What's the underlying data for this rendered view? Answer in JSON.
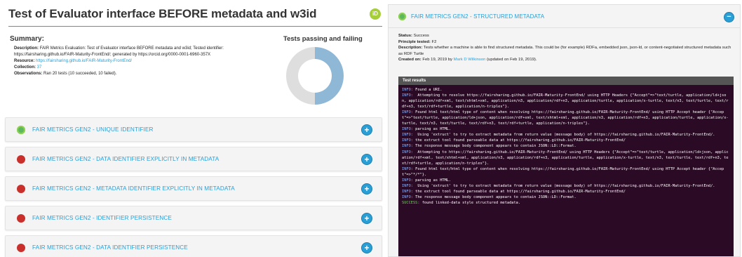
{
  "page": {
    "title": "Test of Evaluator interface BEFORE metadata and w3id",
    "orcid_badge": "iD"
  },
  "summary": {
    "heading": "Summary:",
    "description_label": "Description:",
    "description": "FAIR Metrics Evaluation: Test of Evaluator interface BEFORE metadata and w3id; Tested identifier: https://fairsharing.github.io/FAIR-Maturity-FrontEnd/; generated by https://orcid.org/0000-0001-6960-357X",
    "resource_label": "Resource:",
    "resource": "https://fairsharing.github.io/FAIR-Maturity-FrontEnd/",
    "collection_label": "Collection:",
    "collection": "37",
    "observations_label": "Observations:",
    "observations": "Ran 20 tests (10 succeeded, 10 failed)."
  },
  "donut": {
    "title": "Tests passing and failing",
    "passed": 10,
    "failed": 10,
    "colors": {
      "passed": "#8fb7d6",
      "failed": "#dedede"
    }
  },
  "tests": [
    {
      "label": "FAIR METRICS GEN2 - UNIQUE IDENTIFIER",
      "status": "pass"
    },
    {
      "label": "FAIR METRICS GEN2 - DATA IDENTIFIER EXPLICITLY IN METADATA",
      "status": "fail"
    },
    {
      "label": "FAIR METRICS GEN2 - METADATA IDENTIFIER EXPLICITLY IN METADATA",
      "status": "fail"
    },
    {
      "label": "FAIR METRICS GEN2 - IDENTIFIER PERSISTENCE",
      "status": "fail"
    },
    {
      "label": "FAIR METRICS GEN2 - DATA IDENTIFIER PERSISTENCE",
      "status": "fail"
    }
  ],
  "expand_symbol": "+",
  "collapse_symbol": "−",
  "detail": {
    "title": "FAIR METRICS GEN2 - STRUCTURED METADATA",
    "status_label": "Status:",
    "status": "Success",
    "principle_label": "Principle tested:",
    "principle": "F2",
    "description_label": "Description:",
    "description": "Tests whether a machine is able to find structured metadata. This could be (for example) RDFa, embedded json, json-ld, or content-negotiated structured metadata such as RDF Turtle",
    "created_label": "Created on:",
    "created_date": "Feb 19, 2019",
    "created_by": "by",
    "author": "Mark D Wilkinson",
    "updated": "(updated on Feb 19, 2019)."
  },
  "results": {
    "heading": "Test results",
    "lines": [
      {
        "level": "INFO:",
        "text": " Found a URI."
      },
      {
        "level": "INFO:",
        "text": "  Attempting to resolve https://fairsharing.github.io/FAIR-Maturity-FrontEnd/ using HTTP Headers {\"Accept\"=>\"text/turtle, application/ld+json, application/rdf+xml, text/xhtml+xml, application/n3, application/rdf+n3, application/turtle, application/x-turtle, text/n3, text/turtle, text/rdf+n3, text/rdf+turtle, application/n-triples\"}."
      },
      {
        "level": "INFO:",
        "text": " Found html text/html type of content when resolving https://fairsharing.github.io/FAIR-Maturity-FrontEnd/ using HTTP Accept header {\"Accept\"=>\"text/turtle, application/ld+json, application/rdf+xml, text/xhtml+xml, application/n3, application/rdf+n3, application/turtle, application/x-turtle, text/n3, text/turtle, text/rdf+n3, text/rdf+turtle, application/n-triples\"}."
      },
      {
        "level": "INFO:",
        "text": " parsing as HTML."
      },
      {
        "level": "INFO:",
        "text": "  Using 'extruct' to try to extract metadata from return value (message body) of https://fairsharing.github.io/FAIR-Maturity-FrontEnd/."
      },
      {
        "level": "INFO:",
        "text": " the extruct tool found parseable data at https://fairsharing.github.io/FAIR-Maturity-FrontEnd/"
      },
      {
        "level": "INFO:",
        "text": " The response message body component appears to contain JSON::LD::Format."
      },
      {
        "level": "INFO:",
        "text": "  Attempting to https://fairsharing.github.io/FAIR-Maturity-FrontEnd/ using HTTP Headers {\"Accept\"=>\"text/turtle, application/ld+json, application/rdf+xml, text/xhtml+xml, application/n3, application/rdf+n3, application/turtle, application/x-turtle, text/n3, text/turtle, text/rdf+n3, text/rdf+turtle, application/n-triples\"}."
      },
      {
        "level": "INFO:",
        "text": " Found html text/html type of content when resolving https://fairsharing.github.io/FAIR-Maturity-FrontEnd/ using HTTP Accept header {\"Accept\"=>\"*/*\"}."
      },
      {
        "level": "INFO:",
        "text": " parsing as HTML."
      },
      {
        "level": "INFO:",
        "text": "  Using 'extruct' to try to extract metadata from return value (message body) of https://fairsharing.github.io/FAIR-Maturity-FrontEnd/."
      },
      {
        "level": "INFO:",
        "text": " the extruct tool found parseable data at https://fairsharing.github.io/FAIR-Maturity-FrontEnd/"
      },
      {
        "level": "INFO:",
        "text": " The response message body component appears to contain JSON::LD::Format."
      },
      {
        "level": "SUCCESS:",
        "text": " found linked-data style structured metadata."
      }
    ]
  }
}
